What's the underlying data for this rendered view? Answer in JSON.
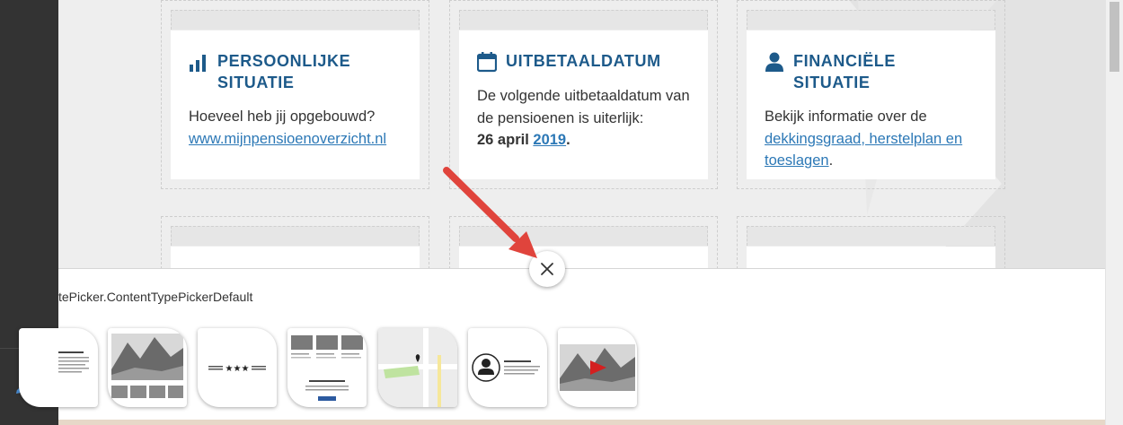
{
  "colors": {
    "sidebar": "#333333",
    "heading": "#1d5a8a",
    "link": "#2c78b6",
    "arrow": "#e0443c",
    "video_play": "#d41f1f"
  },
  "cards": [
    {
      "icon": "bar-chart-icon",
      "title": "PERSOONLIJKE SITUATIE",
      "line1": "Hoeveel heb jij opgebouwd?",
      "link": "www.mijnpensioenoverzicht.nl"
    },
    {
      "icon": "calendar-icon",
      "title": "UITBETAALDATUM",
      "line1": "De volgende uitbetaaldatum van de pensioenen is uiterlijk:",
      "date_bold": "26 april",
      "date_link": "2019",
      "date_end": "."
    },
    {
      "icon": "person-icon",
      "title": "FINANCIËLE SITUATIE",
      "line1": "Bekijk informatie over de",
      "link": "dekkingsgraad, herstelplan en toeslagen",
      "link_end": "."
    }
  ],
  "picker": {
    "label": "tePicker.ContentTypePickerDefault",
    "templates": [
      {
        "name": "text-block-template"
      },
      {
        "name": "image-gallery-template"
      },
      {
        "name": "divider-stars-template",
        "stars": "★★★"
      },
      {
        "name": "three-column-template"
      },
      {
        "name": "map-template",
        "icon": "map-pin-icon"
      },
      {
        "name": "profile-template",
        "icon": "person-icon"
      },
      {
        "name": "video-template",
        "icon": "play-icon"
      }
    ]
  },
  "toolbar": {
    "edit_icon": "pencil-icon",
    "close_icon": "close-icon"
  }
}
